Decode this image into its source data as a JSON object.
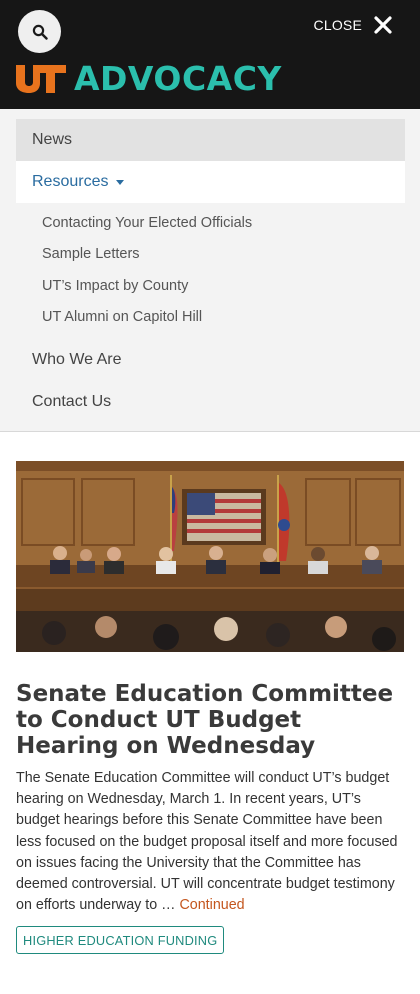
{
  "header": {
    "close_label": "CLOSE",
    "logo_text": "ADVOCACY",
    "logo_mark": "UT",
    "brand_orange": "#e8731d",
    "brand_teal": "#2bbfad",
    "icons": {
      "search": "search-icon",
      "close": "close-icon"
    }
  },
  "menu": {
    "news": "News",
    "resources": "Resources",
    "resources_sub": [
      "Contacting Your Elected Officials",
      "Sample Letters",
      "UT’s Impact by County",
      "UT Alumni on Capitol Hill"
    ],
    "who": "Who We Are",
    "contact": "Contact Us"
  },
  "article": {
    "title": "Senate Education Committee to Conduct UT Budget Hearing on Wednesday",
    "excerpt": "The Senate Education Committee will conduct UT’s budget hearing on Wednesday, March 1.  In recent years, UT’s budget hearings before this Senate Committee have been less focused on the budget proposal itself and more focused on issues facing the University that the Committee has deemed controversial.  UT will concentrate budget testimony on efforts underway to … ",
    "continued": "Continued",
    "tag": "HIGHER EDUCATION FUNDING"
  }
}
